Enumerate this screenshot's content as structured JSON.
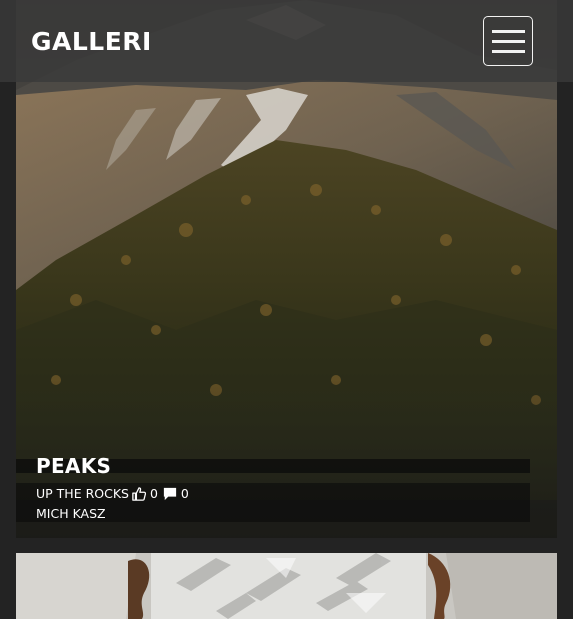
{
  "header": {
    "brand": "GALLERI"
  },
  "posts": [
    {
      "title": "PEAKS",
      "subtitle": "UP THE ROCKS",
      "likes": "0",
      "comments": "0",
      "author": "MICH KASZ",
      "like_icon": "thumbs-up-icon",
      "comment_icon": "comment-icon"
    }
  ],
  "colors": {
    "background": "#232323",
    "navbar": "#3a3a3a",
    "text": "#ffffff"
  }
}
